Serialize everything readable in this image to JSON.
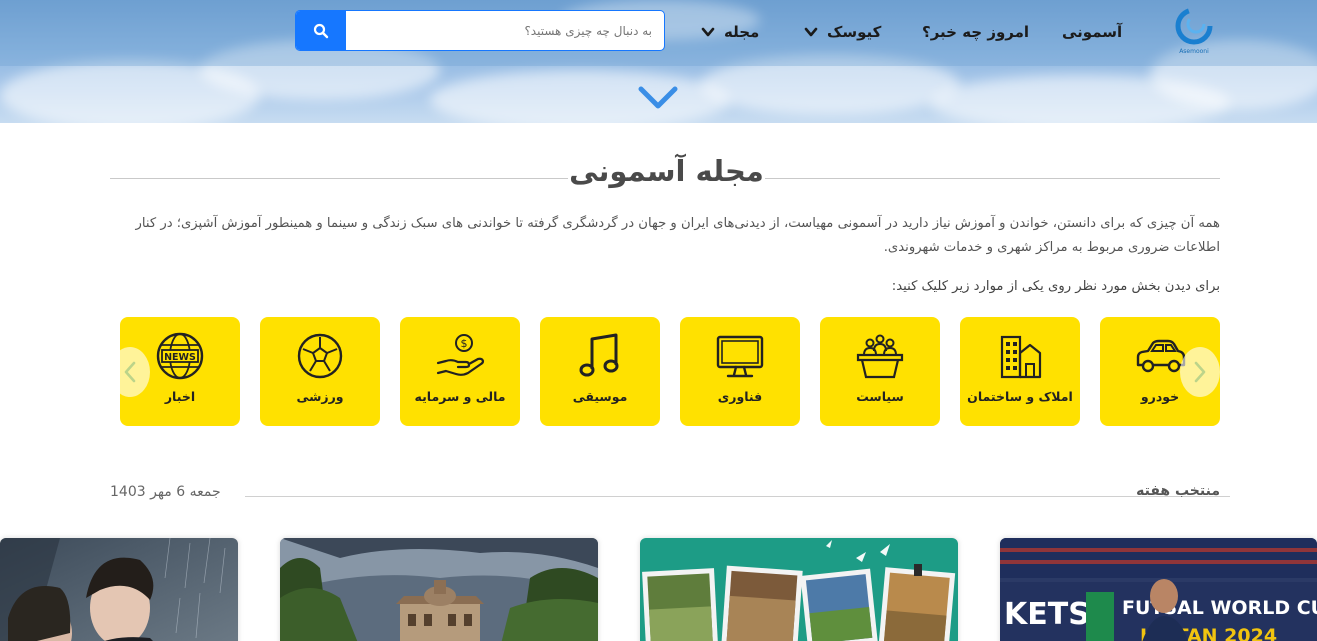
{
  "nav": {
    "logo_text": "Asemooni",
    "items": [
      {
        "label": "آسمونی"
      },
      {
        "label": "امروز چه خبر؟"
      },
      {
        "label": "کیوسک"
      },
      {
        "label": "مجله"
      }
    ]
  },
  "search": {
    "placeholder": "به دنبال چه چیزی هستید؟"
  },
  "section": {
    "title": "مجله آسمونی",
    "intro": "همه آن چیزی که برای دانستن، خواندن و آموزش نیاز دارید در آسمونی مهیاست، از دیدنی‌های ایران و جهان در گردشگری گرفته تا خواندنی های سبک زندگی و سینما و همینطور آموزش آشپزی؛ در کنار اطلاعات ضروری مربوط به مراکز شهری و خدمات شهروندی.",
    "hint": "برای دیدن بخش مورد نظر روی یکی از موارد زیر کلیک کنید:"
  },
  "categories": [
    {
      "label": "خودرو",
      "icon": "car-icon"
    },
    {
      "label": "املاک و ساختمان",
      "icon": "building-icon"
    },
    {
      "label": "سیاست",
      "icon": "podium-icon"
    },
    {
      "label": "فناوری",
      "icon": "monitor-icon"
    },
    {
      "label": "موسیقی",
      "icon": "music-note-icon"
    },
    {
      "label": "مالی و سرمایه",
      "icon": "money-hand-icon"
    },
    {
      "label": "ورزشی",
      "icon": "soccer-ball-icon"
    },
    {
      "label": "اخبار",
      "icon": "news-globe-icon"
    }
  ],
  "week": {
    "title": "منتخب هفته",
    "date": "جمعه 6 مهر 1403"
  },
  "articles": [
    {
      "image": "drama-poster"
    },
    {
      "image": "garden-mansion"
    },
    {
      "image": "travel-photos-collage"
    },
    {
      "image": "futsal-world-cup"
    }
  ],
  "colors": {
    "accent": "#1677ff",
    "category_bg": "#ffe100",
    "hero_chevron": "#3a8ee6"
  }
}
